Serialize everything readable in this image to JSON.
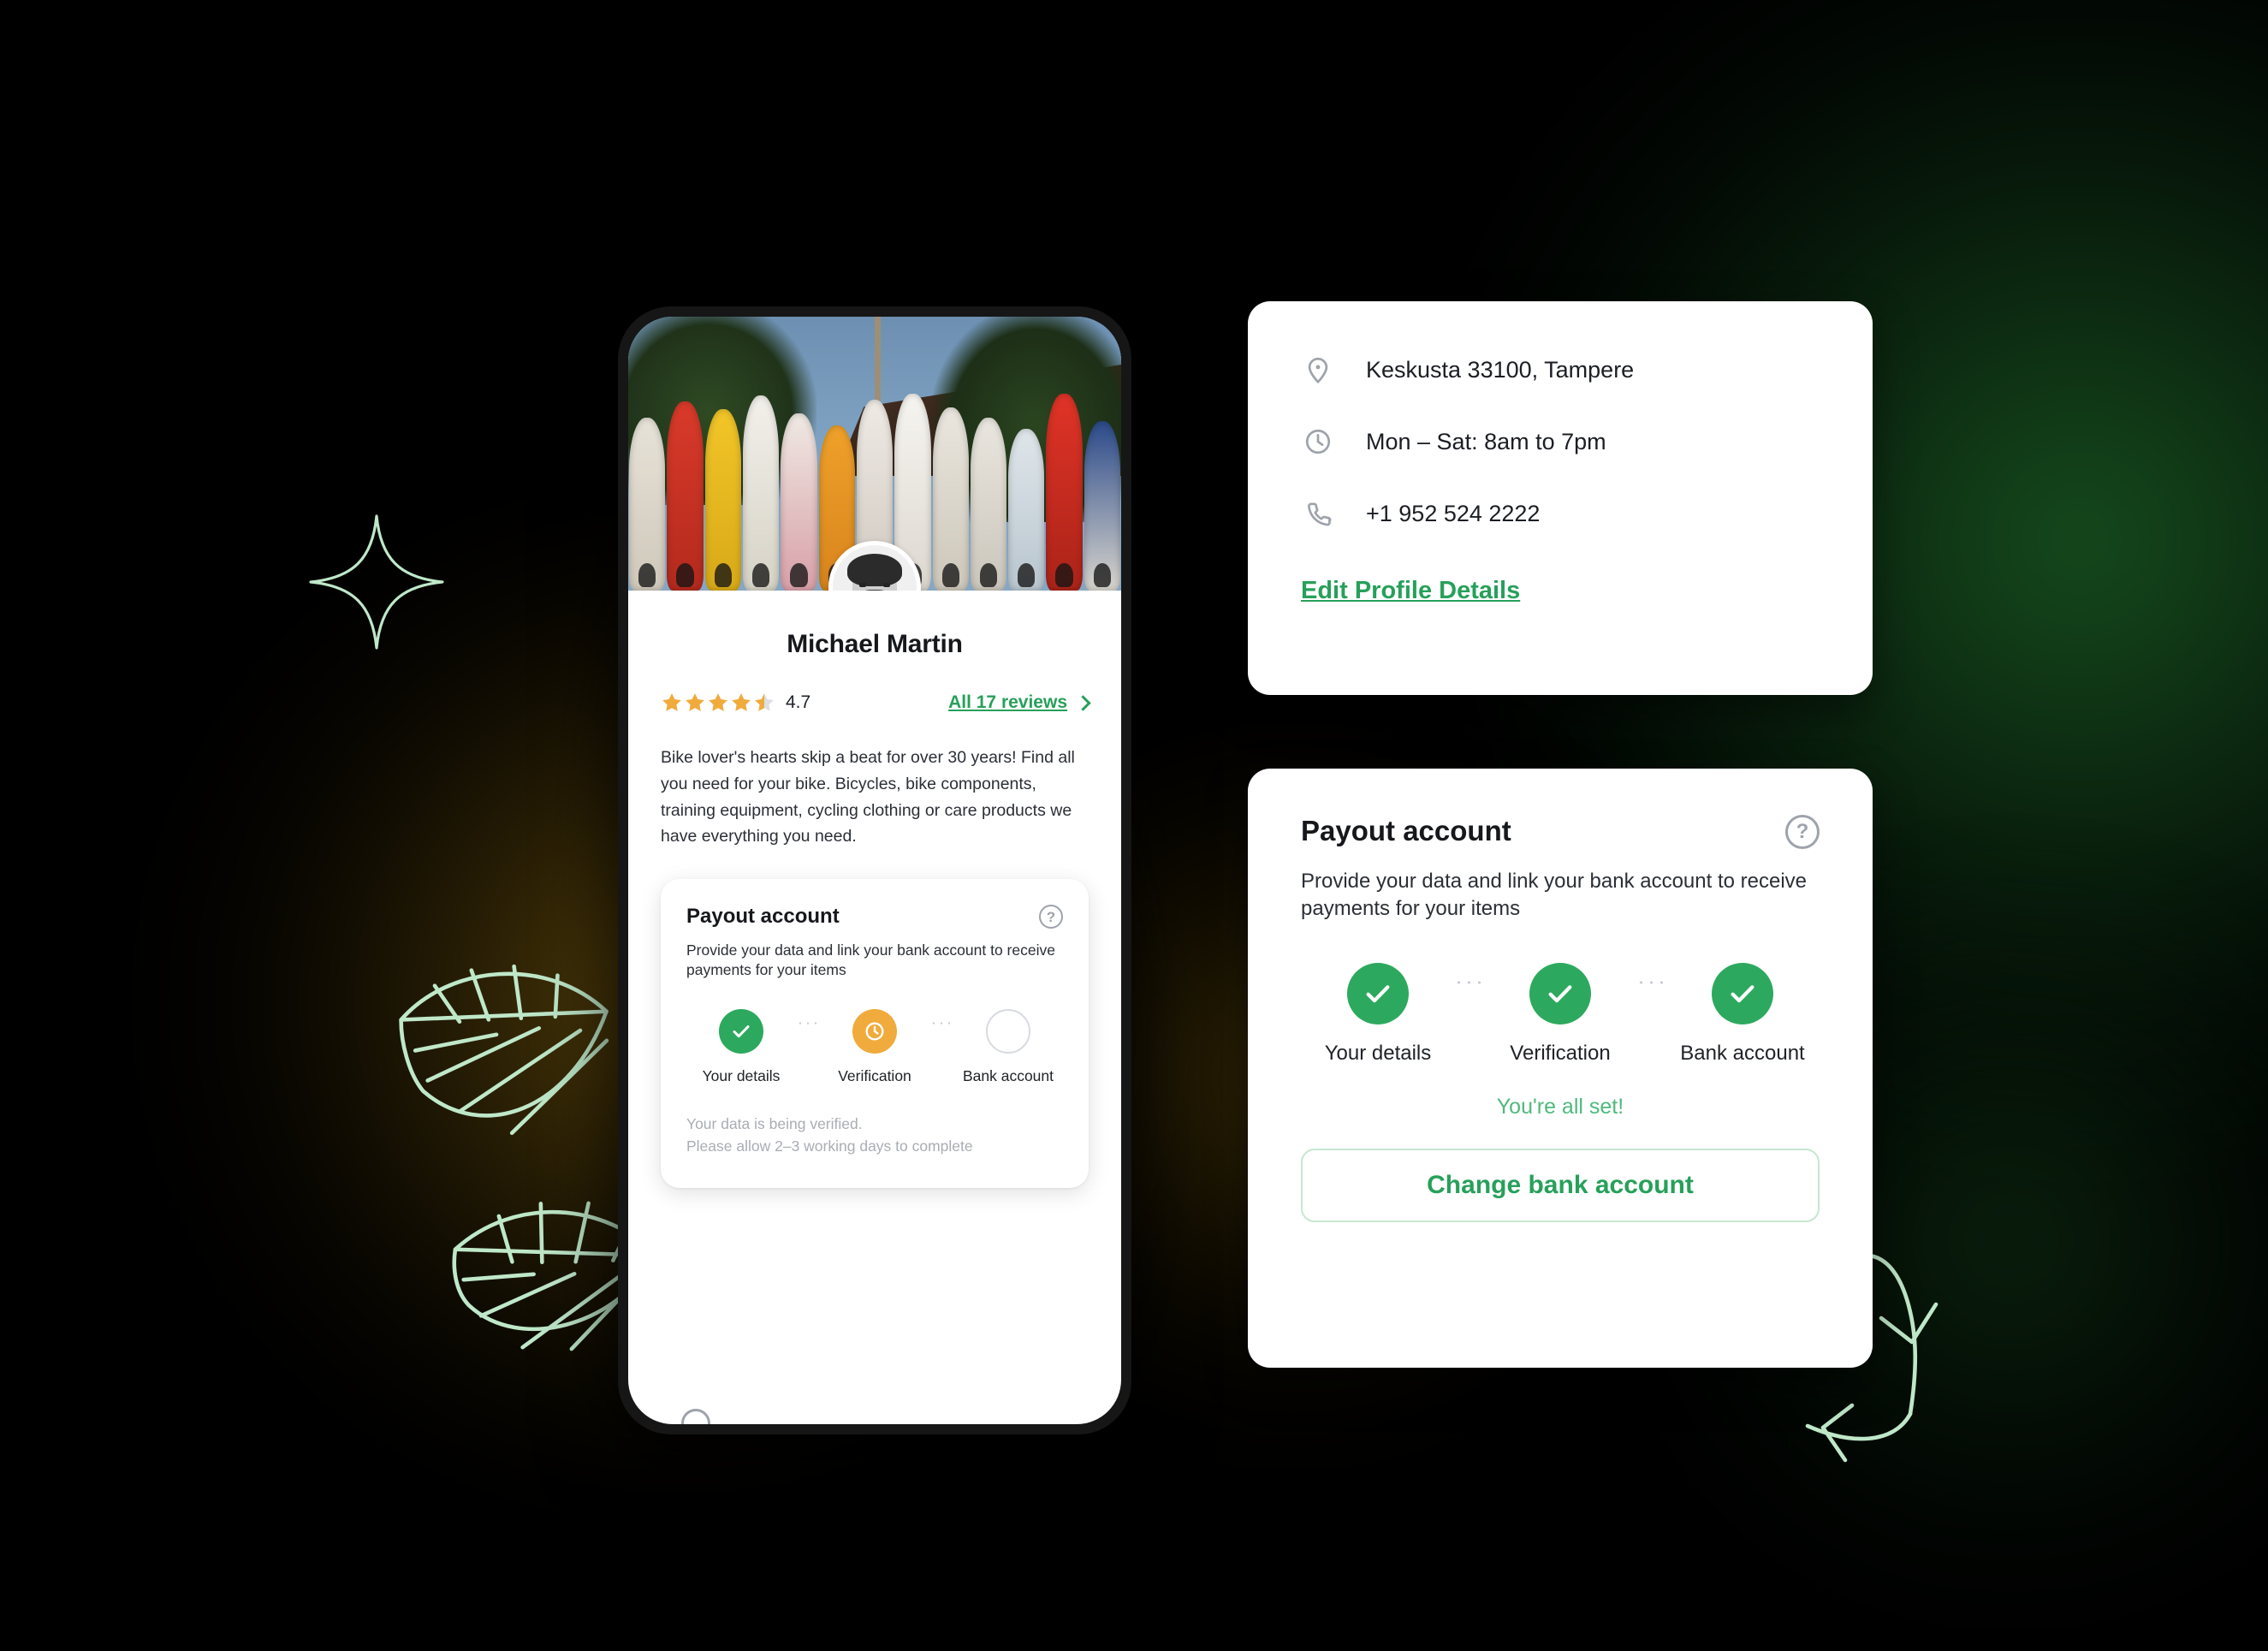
{
  "phone": {
    "profile_name": "Michael Martin",
    "rating": {
      "value": "4.7",
      "stars_filled": 4,
      "stars_half": 1,
      "stars_total": 5,
      "star_color": "#f0ab3c",
      "star_empty_color": "#dcdfe3"
    },
    "reviews_link": "All 17 reviews",
    "bio": "Bike lover's hearts skip a beat for over 30 years! Find all you need for your bike. Bicycles, bike components, training equipment, cycling clothing or care products we have everything you need.",
    "payout_card": {
      "title": "Payout account",
      "help_icon": "question-mark-icon",
      "subtitle": "Provide your data and link your bank account to receive payments for your items",
      "steps": [
        {
          "label": "Your details",
          "state": "done",
          "icon": "check-icon"
        },
        {
          "label": "Verification",
          "state": "pending",
          "icon": "clock-icon"
        },
        {
          "label": "Bank account",
          "state": "empty",
          "icon": "empty-circle-icon"
        }
      ],
      "status_line_1": "Your data is being verified.",
      "status_line_2": "Please allow 2–3 working days to complete"
    }
  },
  "contact_card": {
    "rows": [
      {
        "icon": "location-pin-icon",
        "text": "Keskusta 33100, Tampere"
      },
      {
        "icon": "clock-icon",
        "text": "Mon – Sat: 8am to 7pm"
      },
      {
        "icon": "phone-icon",
        "text": "+1 952 524 2222"
      }
    ],
    "edit_link": "Edit Profile Details"
  },
  "payout_card_large": {
    "title": "Payout account",
    "help_icon": "question-mark-icon",
    "subtitle": "Provide your data and link your bank account to receive payments for your items",
    "steps": [
      {
        "label": "Your details",
        "state": "done",
        "icon": "check-icon"
      },
      {
        "label": "Verification",
        "state": "done",
        "icon": "check-icon"
      },
      {
        "label": "Bank account",
        "state": "done",
        "icon": "check-icon"
      }
    ],
    "all_set_text": "You're all set!",
    "button_label": "Change bank account"
  },
  "decorations": [
    {
      "name": "sparkle-icon",
      "color": "#bfe8c9"
    },
    {
      "name": "leaf-icon",
      "color": "#bfe8c9"
    },
    {
      "name": "leaf-icon",
      "color": "#bfe8c9"
    },
    {
      "name": "recycle-arrows-icon",
      "color": "#bfe8c9"
    }
  ],
  "theme": {
    "background": "#000000",
    "accent_green": "#27a05a",
    "step_green": "#2ca95e",
    "pending_amber": "#f0ab3c",
    "card_white": "#ffffff",
    "glow_green": "#164e1e",
    "glow_amber": "#684e0c"
  }
}
